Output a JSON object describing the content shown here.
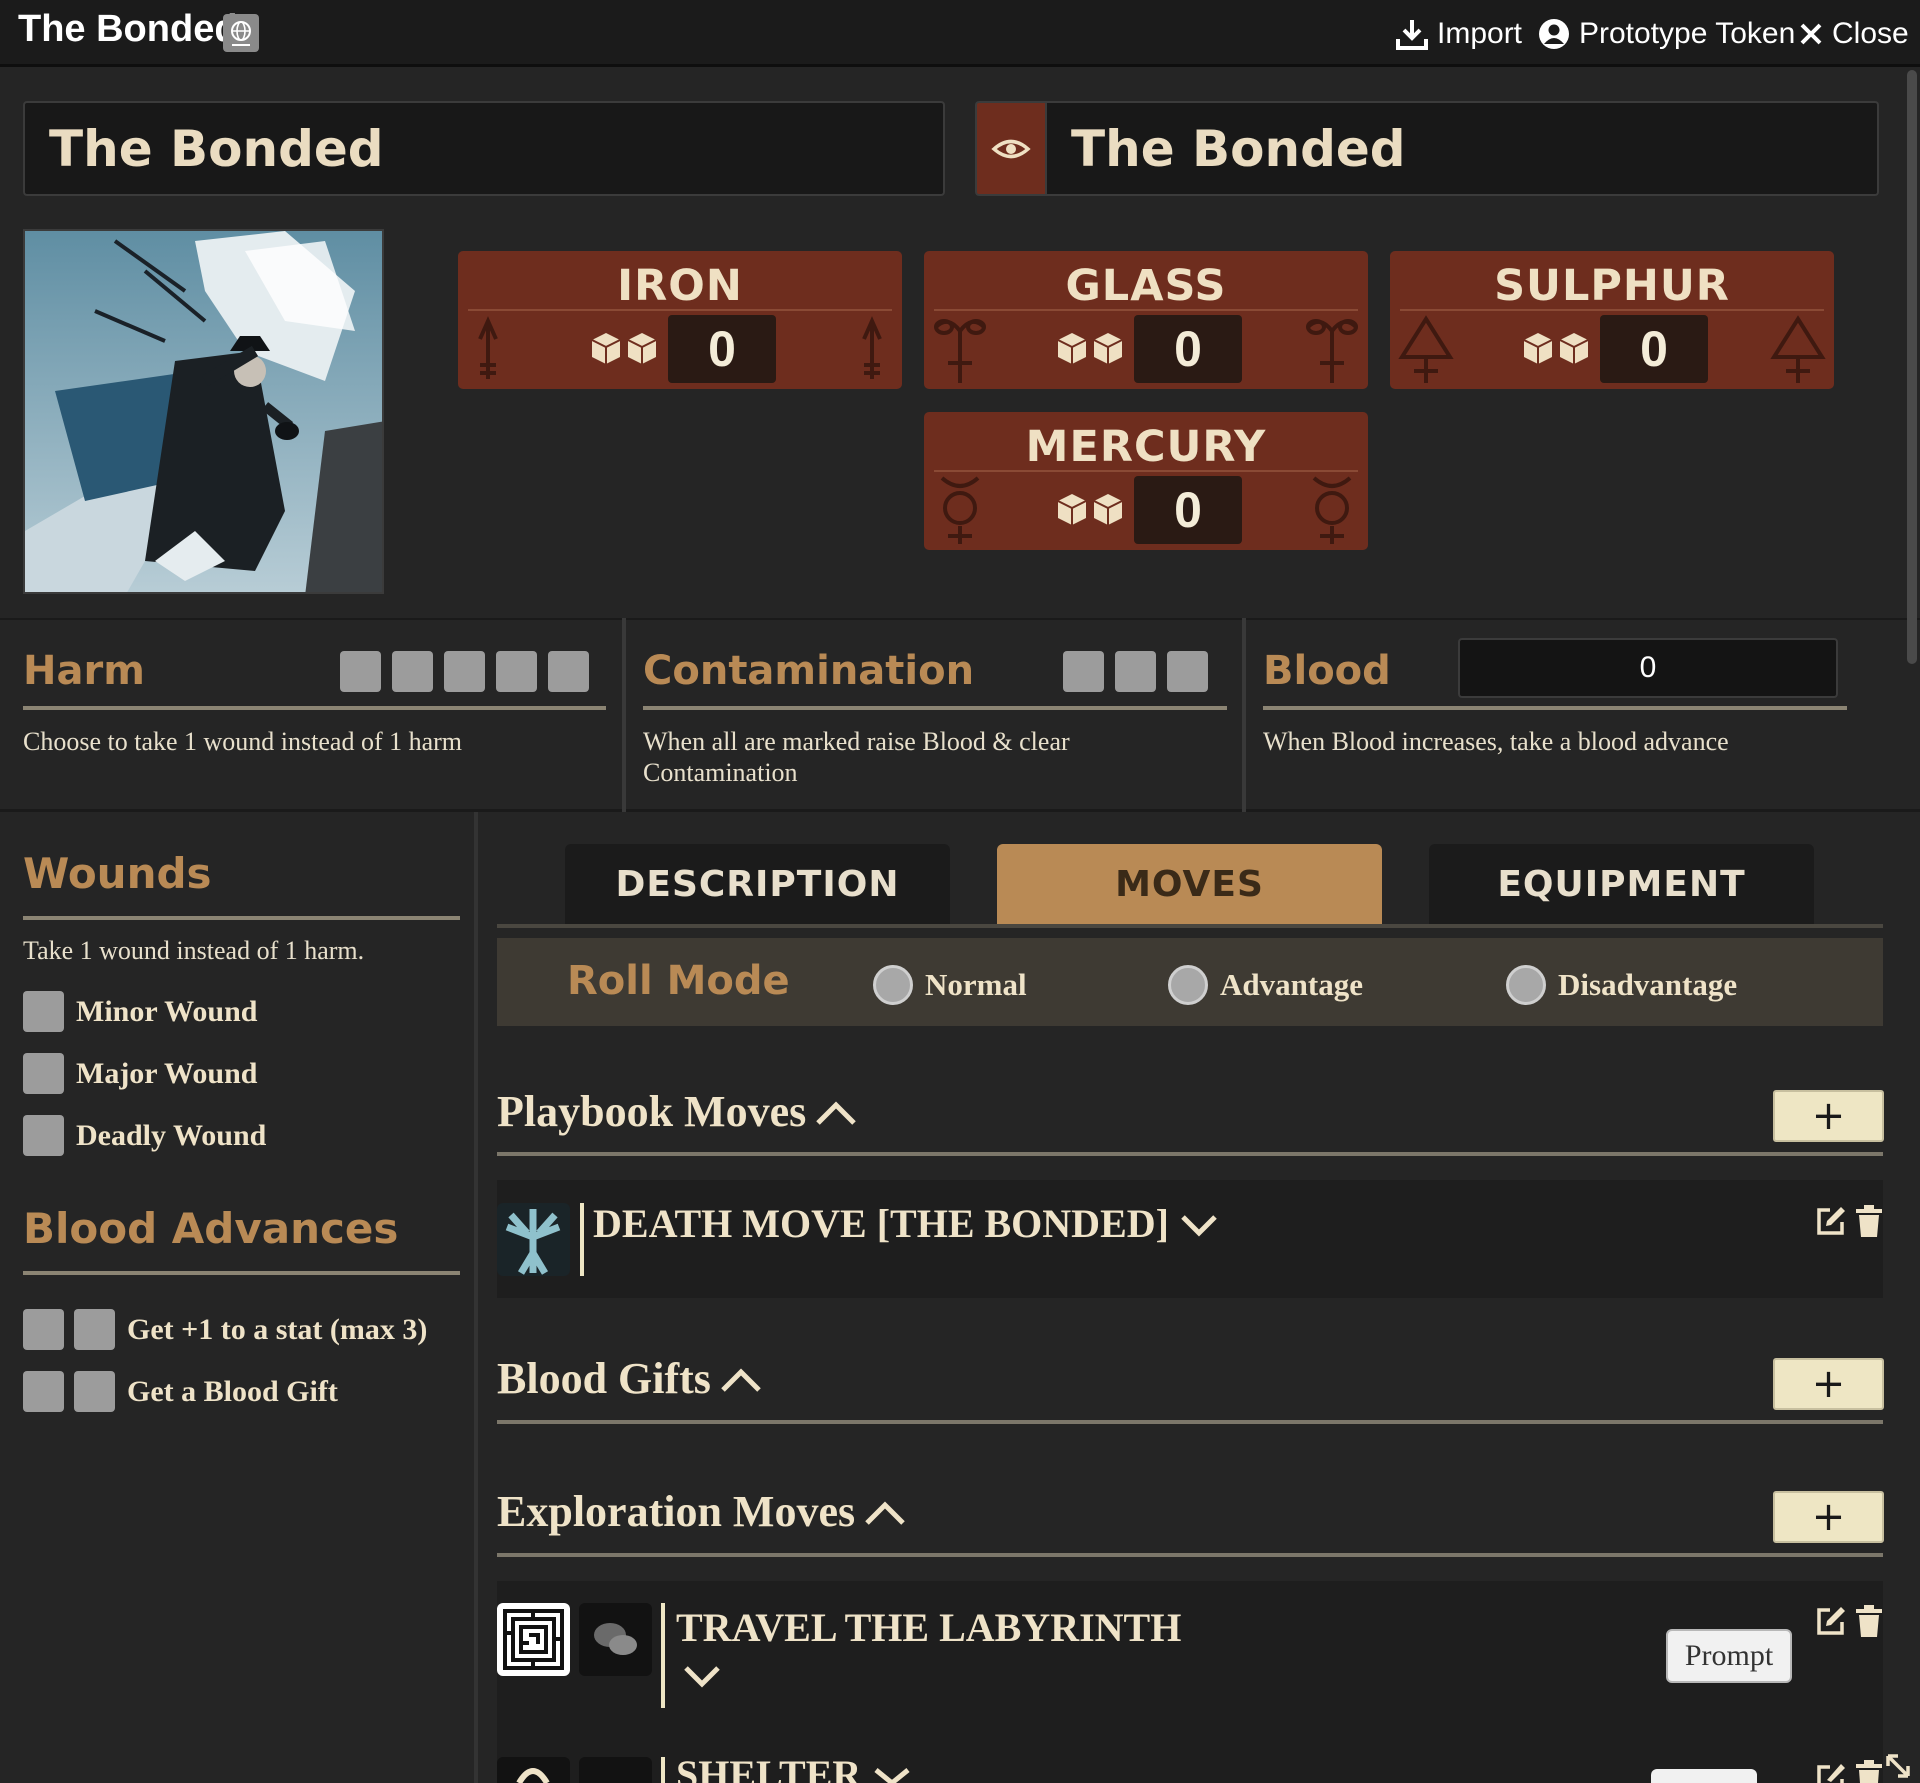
{
  "window": {
    "title": "The Bonded",
    "import_label": "Import",
    "prototype_label": "Prototype Token",
    "close_label": "Close"
  },
  "character": {
    "name": "The Bonded",
    "playbook": "The Bonded"
  },
  "stats": [
    {
      "name": "IRON",
      "value": "0"
    },
    {
      "name": "GLASS",
      "value": "0"
    },
    {
      "name": "SULPHUR",
      "value": "0"
    },
    {
      "name": "MERCURY",
      "value": "0"
    }
  ],
  "harm": {
    "title": "Harm",
    "boxes": 5,
    "description": "Choose to take 1 wound instead of 1 harm"
  },
  "contamination": {
    "title": "Contamination",
    "boxes": 3,
    "description": "When all are marked raise Blood & clear Contamination"
  },
  "blood": {
    "title": "Blood",
    "value": "0",
    "description": "When Blood increases, take a blood advance"
  },
  "wounds": {
    "title": "Wounds",
    "description": "Take 1 wound instead of 1 harm.",
    "items": [
      "Minor Wound",
      "Major Wound",
      "Deadly Wound"
    ]
  },
  "blood_advances": {
    "title": "Blood Advances",
    "items": [
      "Get +1 to a stat (max 3)",
      "Get a Blood Gift"
    ]
  },
  "tabs": [
    {
      "label": "DESCRIPTION",
      "active": false
    },
    {
      "label": "MOVES",
      "active": true
    },
    {
      "label": "EQUIPMENT",
      "active": false
    }
  ],
  "roll_mode": {
    "title": "Roll Mode",
    "options": [
      "Normal",
      "Advantage",
      "Disadvantage"
    ]
  },
  "move_sections": [
    {
      "title": "Playbook Moves",
      "add_label": "+"
    },
    {
      "title": "Blood Gifts",
      "add_label": "+"
    },
    {
      "title": "Exploration Moves",
      "add_label": "+"
    }
  ],
  "moves": {
    "death_move": "DEATH MOVE [THE BONDED]",
    "travel": "TRAVEL THE LABYRINTH",
    "shelter": "SHELTER",
    "prompt_label": "Prompt"
  },
  "colors": {
    "stat_card": "#6e2d1e",
    "accent_gold": "#b98a55",
    "background": "#252525"
  },
  "icons": [
    "globe-icon",
    "download-icon",
    "user-circle-icon",
    "close-icon",
    "eye-icon",
    "dice-icon",
    "chevron-up-icon",
    "chevron-down-icon",
    "edit-icon",
    "trash-icon",
    "chat-icon",
    "labyrinth-icon",
    "resize-icon"
  ]
}
